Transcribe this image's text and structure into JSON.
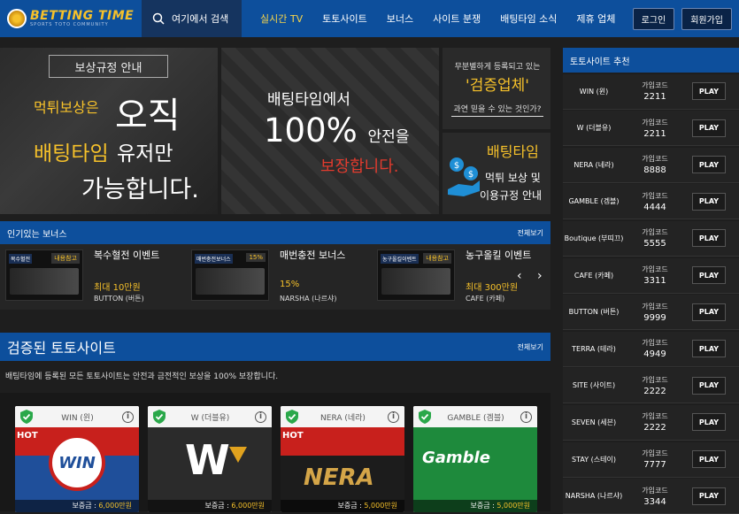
{
  "header": {
    "logo_text": "BETTING TIME",
    "logo_sub": "SPORTS TOTO COMMUNITY",
    "search_label": "여기에서 검색",
    "nav": [
      "실시간 TV",
      "토토사이트",
      "보너스",
      "사이트 분쟁",
      "배팅타임 소식",
      "제휴 업체"
    ],
    "login": "로그인",
    "signup": "회원가입"
  },
  "banner1": {
    "tag": "보상규정 안내",
    "l1a": "먹튀보상은",
    "l1b": "오직",
    "l2a": "배팅타임",
    "l2b": "유저만",
    "l3": "가능합니다."
  },
  "banner2": {
    "l1": "배팅타임에서",
    "l2a": "100%",
    "l2b": "안전을",
    "l3": "보장합니다."
  },
  "banner3": {
    "l1": "무분별하게 등록되고 있는",
    "l2": "'검증업체'",
    "l3": "과연 믿을 수 있는 것인가?"
  },
  "banner4": {
    "l1": "배팅타임",
    "l2": "먹튀 보상 및",
    "l3": "이용규정 안내"
  },
  "bonus": {
    "title": "인기있는 보너스",
    "more": "전체보기",
    "items": [
      {
        "title": "복수혈전 이벤트",
        "price": "최대 10만원",
        "brand": "BUTTON (버튼)",
        "thumb_a": "복수혈전",
        "thumb_b": "내용참고"
      },
      {
        "title": "매번충전 보너스",
        "price": "15%",
        "brand": "NARSHA (나르샤)",
        "thumb_a": "매번충전보너스",
        "thumb_b": "15%"
      },
      {
        "title": "농구올킬 이벤트",
        "price": "최대 300만원",
        "brand": "CAFE (카페)",
        "thumb_a": "농구올킬이벤트",
        "thumb_b": "내용참고"
      }
    ],
    "prev": "‹",
    "next": "›"
  },
  "verified": {
    "title": "검증된 토토사이트",
    "more": "전체보기",
    "desc": "배팅타임에 등록된 모든 토토사이트는 안전과 금전적인 보상을 100% 보장합니다."
  },
  "cards": [
    {
      "name": "WIN (윈)",
      "hot": "HOT",
      "logo": "WIN",
      "dep_label": "보증금 :",
      "dep": "6,000만원",
      "bg": "#1f4f9a"
    },
    {
      "name": "W (더블유)",
      "hot": "",
      "logo": "W",
      "dep_label": "보증금 :",
      "dep": "6,000만원",
      "bg": "#2a2a2a"
    },
    {
      "name": "NERA (네라)",
      "hot": "HOT",
      "logo": "NERA",
      "dep_label": "보증금 :",
      "dep": "5,000만원",
      "bg": "#1c1c1c"
    },
    {
      "name": "GAMBLE (겜블)",
      "hot": "",
      "logo": "Gamble",
      "dep_label": "보증금 :",
      "dep": "5,000만원",
      "bg": "#1e8a3c"
    }
  ],
  "sidebar": {
    "title": "토토사이트 추천",
    "code_label": "가입코드",
    "play": "PLAY",
    "rows": [
      {
        "name": "WIN (윈)",
        "code": "2211"
      },
      {
        "name": "W (더블유)",
        "code": "2211"
      },
      {
        "name": "NERA (네라)",
        "code": "8888"
      },
      {
        "name": "GAMBLE (겜블)",
        "code": "4444"
      },
      {
        "name": "Boutique (부띠끄)",
        "code": "5555"
      },
      {
        "name": "CAFE (카페)",
        "code": "3311"
      },
      {
        "name": "BUTTON (버튼)",
        "code": "9999"
      },
      {
        "name": "TERRA (테라)",
        "code": "4949"
      },
      {
        "name": "SITE (사이트)",
        "code": "2222"
      },
      {
        "name": "SEVEN (세븐)",
        "code": "2222"
      },
      {
        "name": "STAY (스테이)",
        "code": "7777"
      },
      {
        "name": "NARSHA (나르샤)",
        "code": "3344"
      }
    ]
  }
}
